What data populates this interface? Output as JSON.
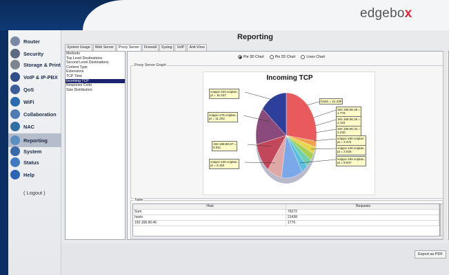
{
  "header": {
    "logo_main": "edgebo",
    "logo_accent": "x"
  },
  "sidebar": {
    "items": [
      {
        "label": "Router",
        "icon": "router-icon",
        "color": "#7a8aa6"
      },
      {
        "label": "Security",
        "icon": "security-icon",
        "color": "#5d6b82"
      },
      {
        "label": "Storage & Print",
        "icon": "storage-icon",
        "color": "#7d858f"
      },
      {
        "label": "VoIP & IP-PBX",
        "icon": "phone-icon",
        "color": "#2f4f8a"
      },
      {
        "label": "QoS",
        "icon": "qos-icon",
        "color": "#3b5f9a"
      },
      {
        "label": "WiFi",
        "icon": "wifi-icon",
        "color": "#2b6bb0"
      },
      {
        "label": "Collaboration",
        "icon": "collaboration-icon",
        "color": "#4f7bb3"
      },
      {
        "label": "NAC",
        "icon": "nac-icon",
        "color": "#2f6fa2"
      },
      {
        "label": "Reporting",
        "icon": "reporting-icon",
        "color": "#5b8fc3"
      },
      {
        "label": "System",
        "icon": "system-icon",
        "color": "#3a6aa5"
      },
      {
        "label": "Status",
        "icon": "status-icon",
        "color": "#3f7cbf"
      },
      {
        "label": "Help",
        "icon": "help-icon",
        "color": "#2b64b5"
      }
    ],
    "logout": "( Logout )"
  },
  "main": {
    "title": "Reporting",
    "tabs": [
      "System Usage",
      "Web Server",
      "Proxy Server",
      "Firewall",
      "Syslog",
      "VoIP",
      "Anti-Virus"
    ],
    "list_items": [
      "Methods",
      "Top Level Destinations",
      "Second Level Destinations",
      "Content Type",
      "Extensions",
      "TCP Time",
      "Incoming TCP",
      "Response Code",
      "Size Distribution"
    ],
    "radios": [
      "Pie 3D Chart",
      "Pie 2D Chart",
      "Lines Chart"
    ],
    "graph_label": "Proxy Server Graph",
    "table_label": "Table",
    "table": {
      "headers": [
        "Host",
        "Requests"
      ],
      "rows": [
        [
          "Sum",
          "76272"
        ],
        [
          "hosts",
          "21438"
        ],
        [
          "192.168.90.46",
          "1776"
        ]
      ]
    },
    "export_label": "Export as PDF"
  },
  "chart_data": {
    "type": "pie",
    "title": "Incoming TCP",
    "series": [
      {
        "name": "hosts",
        "value": 21.438
      },
      {
        "name": "192.168.90.46",
        "value": 1.776
      },
      {
        "name": "192.168.90.25",
        "value": 2.115
      },
      {
        "name": "192.168.90.32",
        "value": 2.24
      },
      {
        "name": "voippo-160.voiplan.",
        "value": 2.371
      },
      {
        "name": "voippo-140.voiplan.",
        "value": 2.626
      },
      {
        "name": "voippo-184.voiplan.",
        "value": 8.947
      },
      {
        "name": "voippo-130.voiplan.",
        "value": 6.11
      },
      {
        "name": "192.168.90.87",
        "value": 8.911
      },
      {
        "name": "voippo-175.voiplan.",
        "value": 11.202
      },
      {
        "name": "voippo-103.voiplan.",
        "value": 11.237
      }
    ],
    "callouts": [
      "voippo-103.voiplan.\npt = 11.237",
      "voippo-175.voiplan.\npt = 11.202",
      "192.168.90.87 =\n8.911",
      "voippo-130.voiplan.\npt = 6.110",
      "hosts = 21.438",
      "192.168.90.46 =\n1.776",
      "192.168.90.25 =\n2.115",
      "192.168.90.32 =\n2.240",
      "voippo-160.voiplan.\npt = 2.371",
      "voippo-140.voiplan.\npt = 2.626",
      "voippo-184.voiplan.\npt = 8.947"
    ],
    "colors": [
      "#e95a5d",
      "#f2a04c",
      "#e8d44d",
      "#a9cf54",
      "#6fd0b0",
      "#5bbfe0",
      "#7ba8e8",
      "#e0a7a7",
      "#c2475a",
      "#8a4a7a",
      "#2d3f9b"
    ]
  }
}
